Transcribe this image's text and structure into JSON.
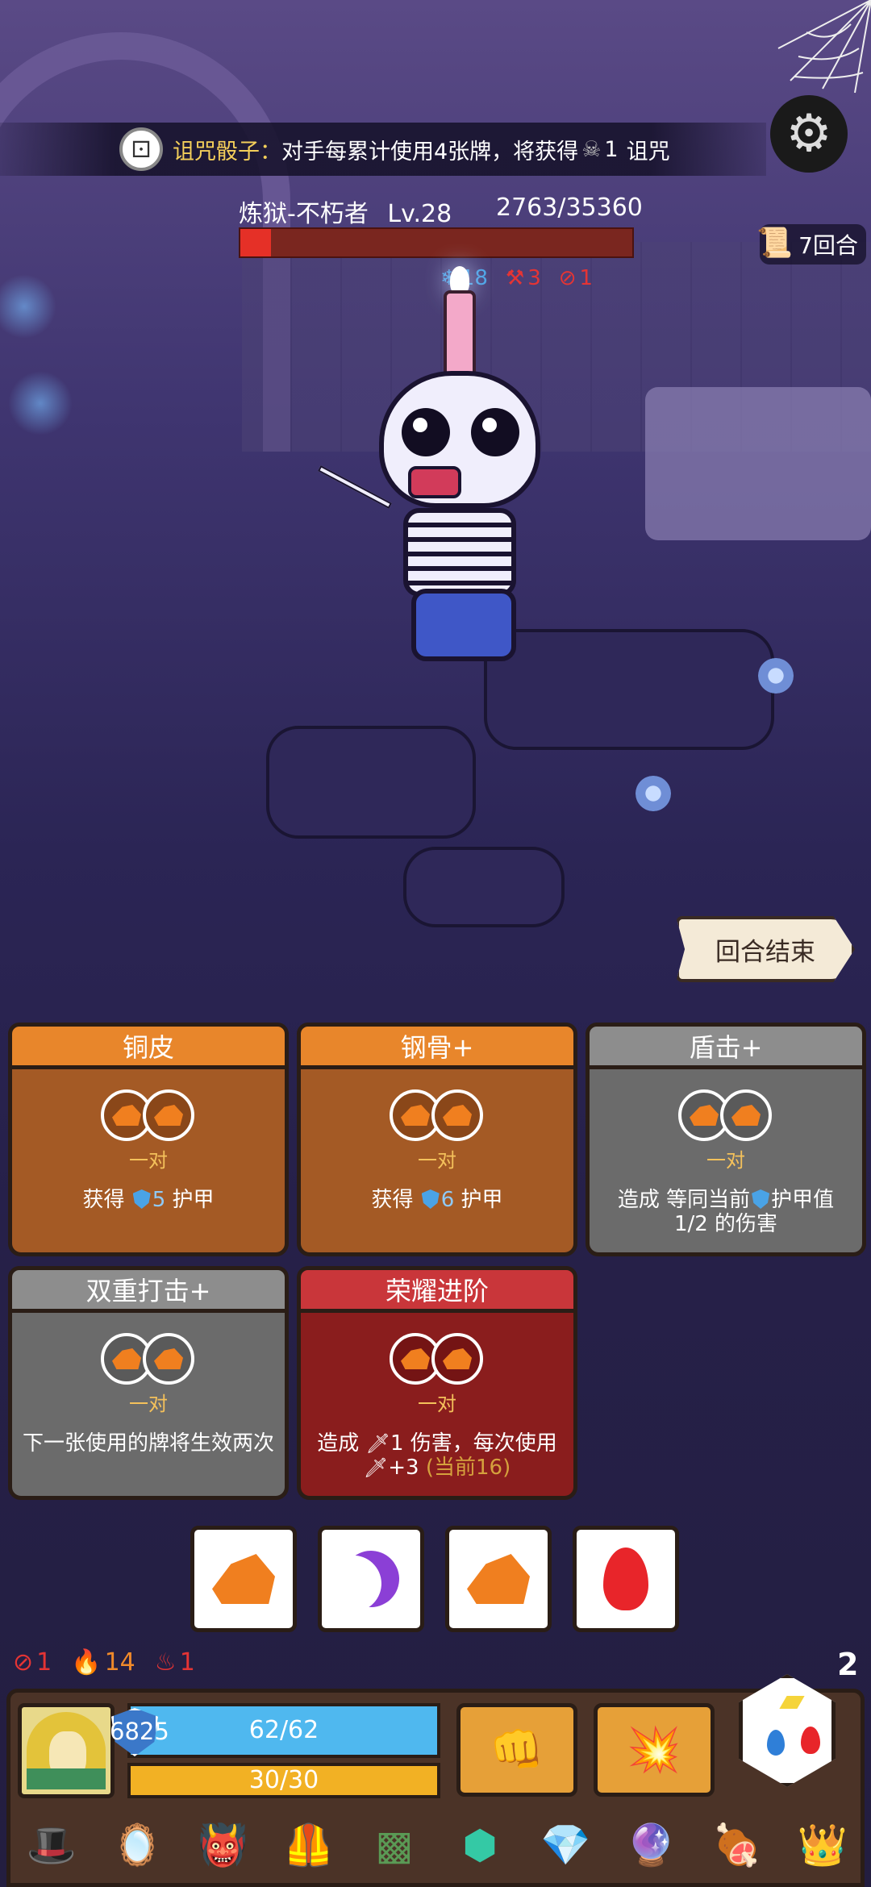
{
  "curse": {
    "name": "诅咒骰子",
    "separator": "：",
    "text": "对手每累计使用4张牌，将获得",
    "count": "1",
    "suffix": "诅咒"
  },
  "boss": {
    "name": "炼狱-不朽者",
    "level": "Lv.28",
    "hp_text": "2763/35360",
    "hp_current": 2763,
    "hp_max": 35360,
    "statuses": [
      {
        "icon": "snowflake-icon",
        "value": "18",
        "color": "#4aa3e6"
      },
      {
        "icon": "axe-icon",
        "value": "3",
        "color": "#e53434"
      },
      {
        "icon": "broken-sword-icon",
        "value": "1",
        "color": "#e53434"
      }
    ]
  },
  "round": "7回合",
  "end_turn_label": "回合结束",
  "cards": [
    {
      "title": "铜皮",
      "pair": "一对",
      "desc_pre": "获得 ",
      "value": "5",
      "desc_post": " 护甲",
      "style": "orange"
    },
    {
      "title": "钢骨+",
      "pair": "一对",
      "desc_pre": "获得 ",
      "value": "6",
      "desc_post": " 护甲",
      "style": "orange"
    },
    {
      "title": "盾击+",
      "pair": "一对",
      "desc_pre": "造成 等同当前",
      "desc_post": "护甲值 1/2 的伤害",
      "style": "gray"
    },
    {
      "title": "双重打击+",
      "pair": "一对",
      "desc": "下一张使用的牌将生效两次",
      "style": "gray"
    },
    {
      "title": "荣耀进阶",
      "pair": "一对",
      "desc_pre": "造成 ",
      "value": "1",
      "desc_mid": " 伤害，每次使用 ",
      "value2": "+3",
      "desc_post": "(当前16)",
      "style": "red"
    }
  ],
  "dice_slots": [
    "rock",
    "moon",
    "rock",
    "fire"
  ],
  "player": {
    "statuses": [
      {
        "icon": "broken-sword-icon",
        "value": "1"
      },
      {
        "icon": "flame-icon",
        "value": "14"
      },
      {
        "icon": "blood-icon",
        "value": "1"
      }
    ],
    "dice_count": "2",
    "armor": "6825",
    "hp_text": "62/62",
    "hp_fraction": 1.0,
    "mp_text": "30/30",
    "mp_fraction": 1.0
  },
  "skills": [
    "spiked-fist-icon",
    "lava-punch-icon"
  ],
  "relics": [
    "wizard-hat-icon",
    "mirror-icon",
    "demon-mask-icon",
    "vest-icon",
    "moss-block-icon",
    "jade-ring-icon",
    "diamond-skull-icon",
    "crystal-icon",
    "meat-leg-icon",
    "golden-crown-icon"
  ],
  "colors": {
    "accent": "#f4cf5a",
    "hp": "#4fb8ef",
    "mp": "#f2b124",
    "boss_hp": "#e53027"
  }
}
